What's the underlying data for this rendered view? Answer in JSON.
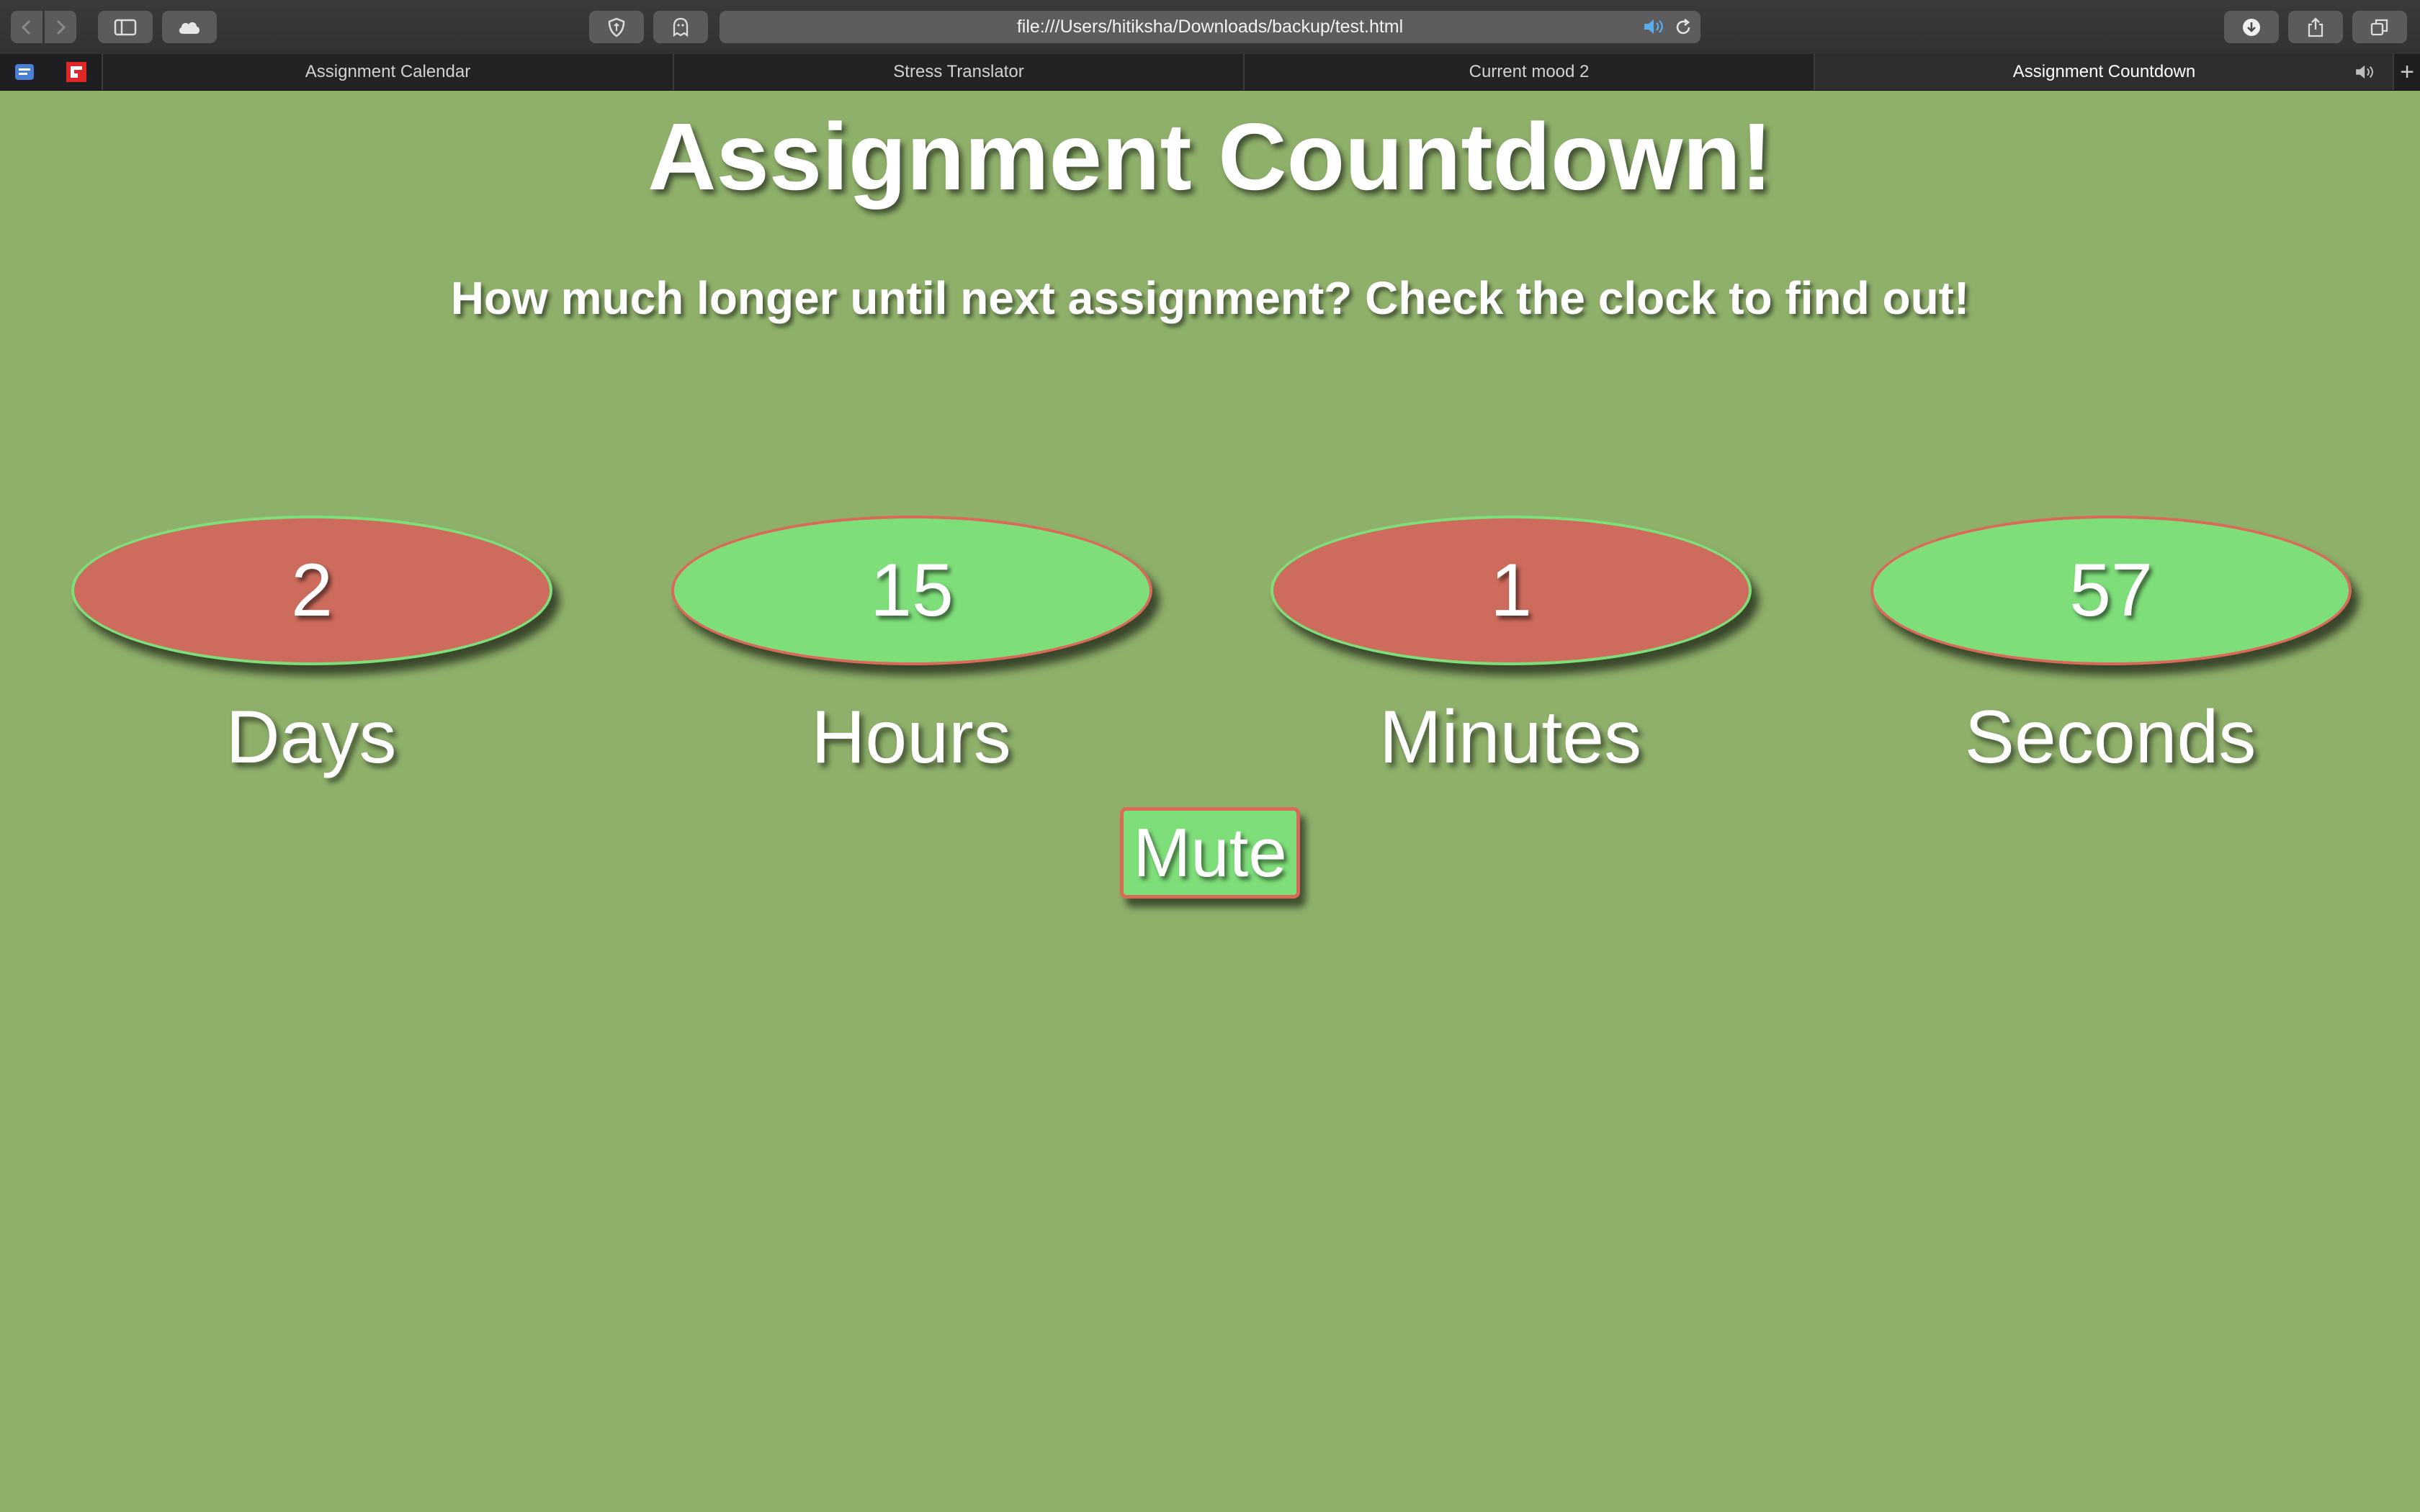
{
  "browser": {
    "url": "file:///Users/hitiksha/Downloads/backup/test.html",
    "tabs": [
      {
        "label": "Assignment Calendar",
        "active": false
      },
      {
        "label": "Stress Translator",
        "active": false
      },
      {
        "label": "Current mood 2",
        "active": false
      },
      {
        "label": "Assignment Countdown",
        "active": true
      }
    ],
    "new_tab_label": "+"
  },
  "page": {
    "title": "Assignment Countdown!",
    "subtitle": "How much longer until next assignment? Check the clock to find out!",
    "countdown": [
      {
        "value": "2",
        "label": "Days",
        "fill": "#cd6b5c"
      },
      {
        "value": "15",
        "label": "Hours",
        "fill": "#7ede7a"
      },
      {
        "value": "1",
        "label": "Minutes",
        "fill": "#cd6b5c"
      },
      {
        "value": "57",
        "label": "Seconds",
        "fill": "#7ede7a"
      }
    ],
    "mute_label": "Mute"
  },
  "colors": {
    "background": "#8fb06b",
    "green": "#7ede7a",
    "red": "#cd6b5c"
  }
}
